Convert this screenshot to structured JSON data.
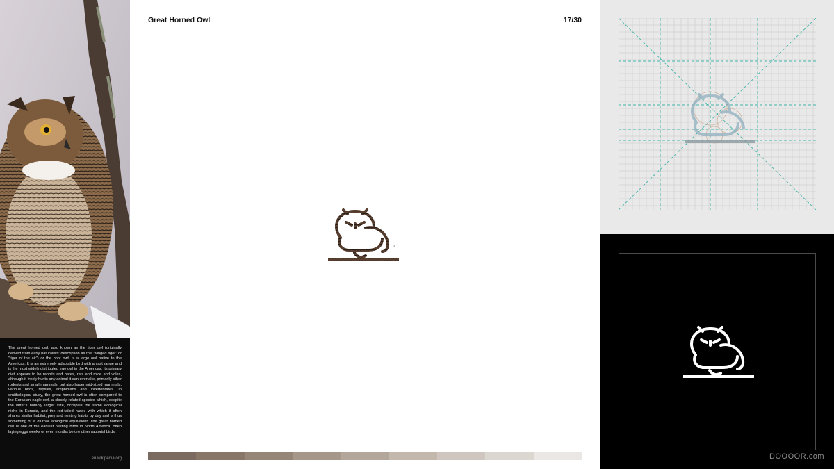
{
  "header": {
    "title": "Great Horned Owl",
    "page_counter": "17/30"
  },
  "sidebar": {
    "description": "The great horned owl, also known as the tiger owl (originally derived from early naturalists' description as the \"winged tiger\" or \"tiger of the air\") or the hoot owl, is a large owl native to the Americas. It is an extremely adaptable bird with a vast range and is the most widely distributed true owl in the Americas. Its primary diet appears to be rabbits and hares, rats and mice and voles, although it freely hunts any animal it can overtake, primarily other rodents and small mammals, but also larger mid-sized mammals, various birds, reptiles, amphibians and invertebrates. In ornithological study, the great horned owl is often compared to the Eurasian eagle-owl, a closely related species which, despite the latter's notably larger size, occupies the same ecological niche in Eurasia, and the red-tailed hawk, with which it often shares similar habitat, prey and nesting habits by day and is thus something of a diurnal ecological equivalent. The great horned owl is one of the earliest nesting birds in North America, often laying eggs weeks or even months before other raptorial birds.",
    "source": "en.wikipedia.org"
  },
  "logo": {
    "registered_mark": "®"
  },
  "palette": [
    "#7b6a5f",
    "#887769",
    "#968678",
    "#a59789",
    "#b3a79b",
    "#c2b8ae",
    "#cfc7bf",
    "#dcd6d0",
    "#ebe7e4"
  ],
  "watermark": "DOOOOR.com",
  "colors": {
    "guide_line": "#3fb3a6",
    "grid_line": "#cfcfcf",
    "dark_bg": "#000000",
    "accent_brown": "#5a4030"
  }
}
